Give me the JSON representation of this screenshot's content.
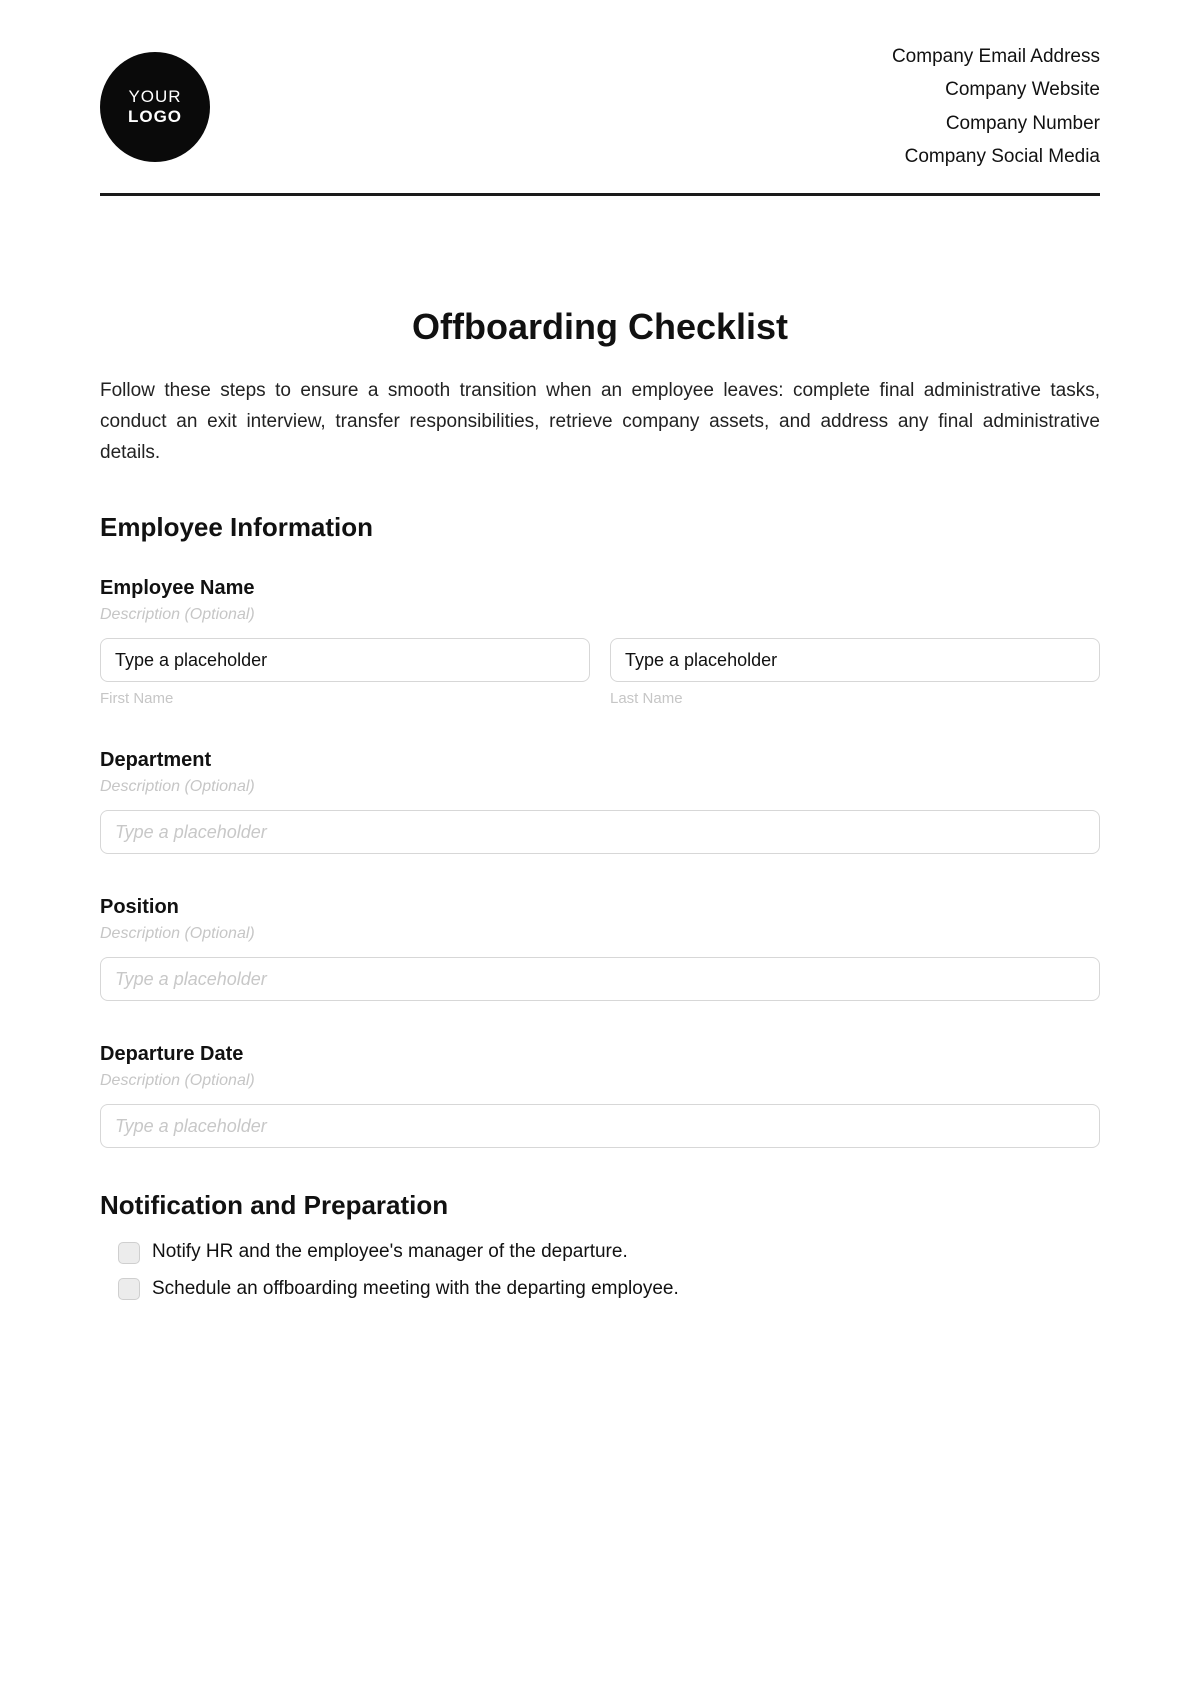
{
  "header": {
    "logo_line1": "YOUR",
    "logo_line2": "LOGO",
    "company": {
      "email": "Company Email Address",
      "website": "Company Website",
      "number": "Company Number",
      "social": "Company Social Media"
    }
  },
  "title": "Offboarding Checklist",
  "intro": "Follow these steps to ensure a smooth transition when an employee leaves: complete final administrative tasks, conduct an exit interview, transfer responsibilities, retrieve company assets, and address any final administrative details.",
  "sections": {
    "employee_info": {
      "heading": "Employee Information",
      "fields": {
        "name": {
          "label": "Employee Name",
          "desc": "Description (Optional)",
          "first_placeholder": "Type a placeholder",
          "last_placeholder": "Type a placeholder",
          "first_sub": "First Name",
          "last_sub": "Last Name"
        },
        "department": {
          "label": "Department",
          "desc": "Description (Optional)",
          "placeholder": "Type a placeholder"
        },
        "position": {
          "label": "Position",
          "desc": "Description (Optional)",
          "placeholder": "Type a placeholder"
        },
        "departure_date": {
          "label": "Departure Date",
          "desc": "Description (Optional)",
          "placeholder": "Type a placeholder"
        }
      }
    },
    "notification": {
      "heading": "Notification and Preparation",
      "items": [
        "Notify HR and the employee's manager of the departure.",
        "Schedule an offboarding meeting with the departing employee."
      ]
    }
  }
}
